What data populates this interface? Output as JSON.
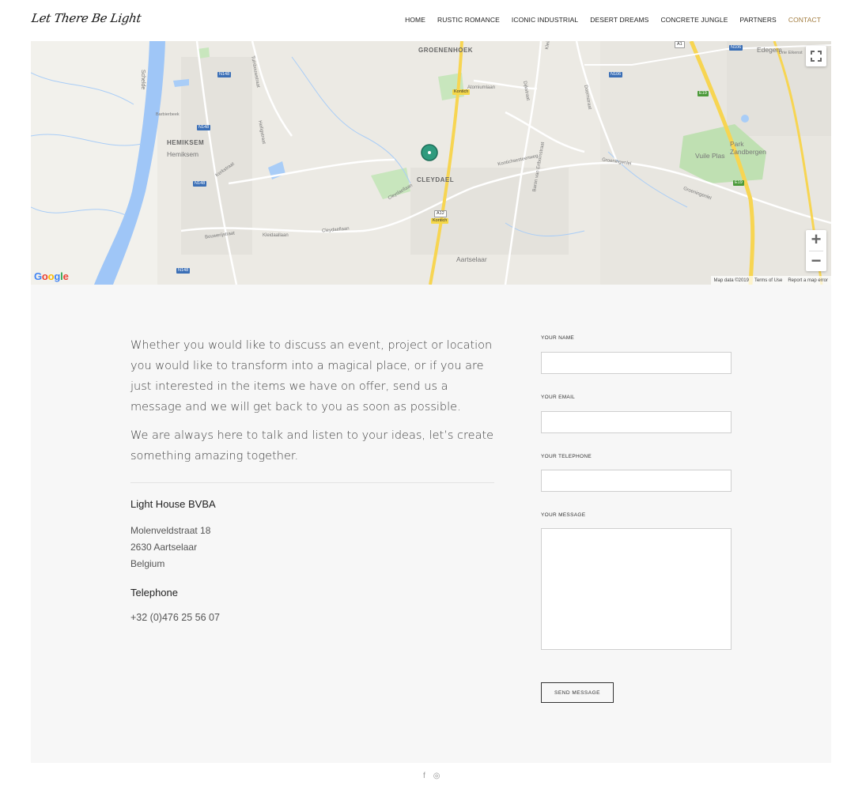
{
  "header": {
    "logo_text": "Let There Be Light",
    "nav": [
      {
        "label": "HOME"
      },
      {
        "label": "RUSTIC ROMANCE"
      },
      {
        "label": "ICONIC INDUSTRIAL"
      },
      {
        "label": "DESERT DREAMS"
      },
      {
        "label": "CONCRETE JUNGLE"
      },
      {
        "label": "PARTNERS"
      },
      {
        "label": "CONTACT",
        "active": true
      }
    ],
    "active_color": "#a27c3f"
  },
  "map": {
    "labels": {
      "groenenhoek": "GROENENHOEK",
      "hemiksem_caps": "HEMIKSEM",
      "hemiksem": "Hemiksem",
      "cleydael": "CLEYDAEL",
      "aartselaar": "Aartselaar",
      "edegem": "Edegem",
      "vuile_plas": "Vuile Plas",
      "park": "Park Zandbergen",
      "schelde": "Schelde",
      "barbierbeek": "Barbierbeek",
      "atomiumlaan": "Atomiumlaan",
      "groeningenlei": "Groeningenlei",
      "kontichsesteenweg": "Kontichsesteenweg",
      "cleydaellaan": "Cleydaellaan",
      "kerkstraat": "Kerkstraat",
      "bouwerijstraat": "Bouwerijstraat",
      "kleidaallaan": "Kleidaallaan",
      "tuinbouwstraat": "Tuinbouwstraat",
      "heiligstraat": "Heiligstraat",
      "dijkstraat": "Dijkstraat",
      "doornstraat": "Doornstraat",
      "kleine_doornstraat": "Kleine Doornstraat",
      "baron": "Baron van Ertbornstraat",
      "kontich1": "Kontich",
      "kontich2": "Kontich",
      "dries": "Drie Eikenst"
    },
    "badges": {
      "n148a": "N148",
      "n148b": "N148",
      "n148c": "N148",
      "n148d": "N148",
      "n106a": "N106",
      "n106b": "N106",
      "e19a": "E19",
      "e19b": "E19",
      "a12": "A12",
      "a1": "A1"
    },
    "google": "Google",
    "footer": {
      "data": "Map data ©2019",
      "terms": "Terms of Use",
      "report": "Report a map error"
    },
    "zoom_in": "+",
    "zoom_out": "−"
  },
  "contact": {
    "intro_p1": "Whether you would like to discuss an event, project or location you would like to transform into a magical place, or if you are just interested in the items we have on offer, send us a message and we will get back to you as soon as possible.",
    "intro_p2": "We are always here to talk and listen to your ideas, let’s create something amazing together.",
    "company": "Light House BVBA",
    "address_line1": "Molenveldstraat 18",
    "address_line2": "2630 Aartselaar",
    "address_line3": "Belgium",
    "telephone_heading": "Telephone",
    "telephone": "+32 (0)476 25 56 07"
  },
  "form": {
    "name_label": "YOUR NAME",
    "email_label": "YOUR EMAIL",
    "telephone_label": "YOUR TELEPHONE",
    "message_label": "YOUR MESSAGE",
    "name_value": "",
    "email_value": "",
    "telephone_value": "",
    "message_value": "",
    "send_label": "SEND MESSAGE"
  },
  "footer": {
    "social": [
      {
        "icon": "facebook-icon",
        "glyph": "f"
      },
      {
        "icon": "instagram-icon",
        "glyph": "◎"
      }
    ]
  }
}
